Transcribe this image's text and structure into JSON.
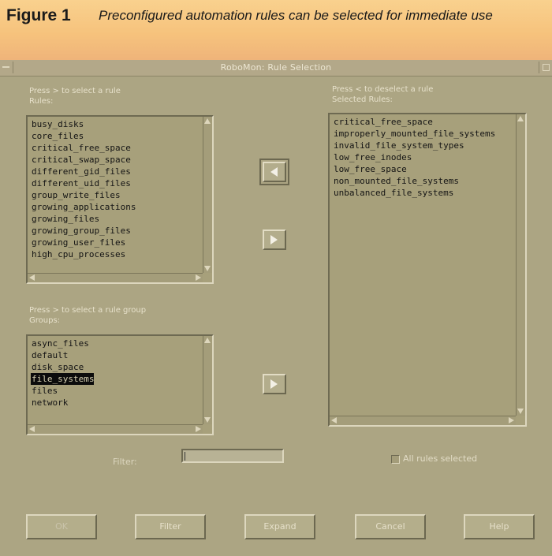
{
  "figure": {
    "label": "Figure 1",
    "caption": "Preconfigured automation rules can be selected for immediate use"
  },
  "window": {
    "title": "RoboMon: Rule Selection"
  },
  "rules_panel": {
    "hint": "Press > to select a rule",
    "heading": "Rules:",
    "items": [
      "busy_disks",
      "core_files",
      "critical_free_space",
      "critical_swap_space",
      "different_gid_files",
      "different_uid_files",
      "group_write_files",
      "growing_applications",
      "growing_files",
      "growing_group_files",
      "growing_user_files",
      "high_cpu_processes"
    ]
  },
  "groups_panel": {
    "hint": "Press > to select a rule group",
    "heading": "Groups:",
    "items": [
      "async_files",
      "default",
      "disk_space",
      "file_systems",
      "files",
      "network"
    ],
    "selected_index": 3
  },
  "selected_panel": {
    "hint": "Press < to deselect a rule",
    "heading": "Selected Rules:",
    "items": [
      "critical_free_space",
      "improperly_mounted_file_systems",
      "invalid_file_system_types",
      "low_free_inodes",
      "low_free_space",
      "non_mounted_file_systems",
      "unbalanced_file_systems"
    ]
  },
  "transfer_buttons": {
    "deselect_icon": "left-triangle-icon",
    "select_rule_icon": "right-triangle-icon",
    "select_group_icon": "right-triangle-icon"
  },
  "filter": {
    "label": "Filter:",
    "value": ""
  },
  "all_rules": {
    "label": "All rules selected",
    "checked": false
  },
  "buttons": {
    "ok": "OK",
    "filter": "Filter",
    "expand": "Expand",
    "cancel": "Cancel",
    "help": "Help"
  },
  "colors": {
    "header_background": "#f6c27c",
    "window_background": "#aca583",
    "list_background": "#a7a07b",
    "selection_background": "#0c0c0c"
  }
}
